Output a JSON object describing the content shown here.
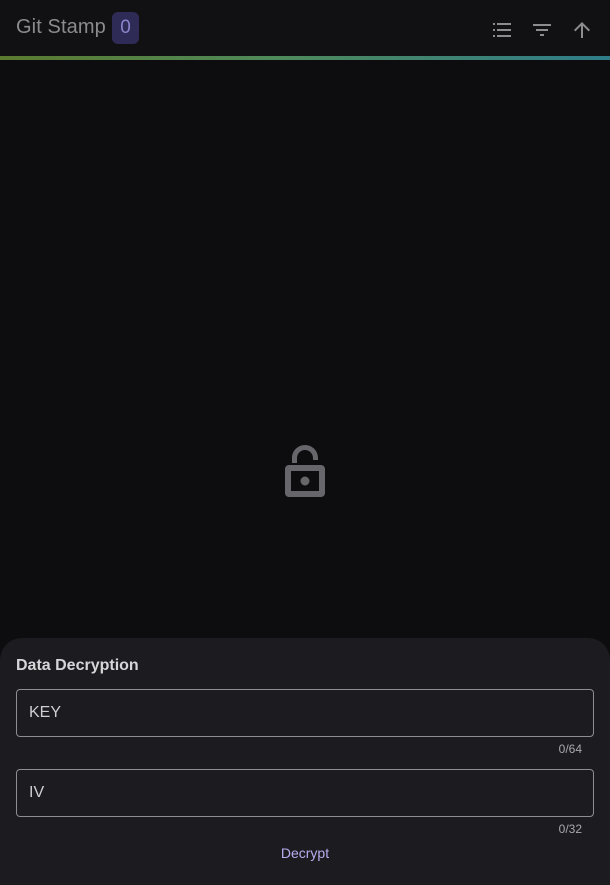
{
  "header": {
    "title": "Git Stamp",
    "count": "0",
    "icons": [
      "list-icon",
      "filter-icon",
      "arrow-up-icon"
    ]
  },
  "main": {
    "center_icon": "lock-open-icon"
  },
  "sheet": {
    "title": "Data Decryption",
    "key_field": {
      "placeholder": "KEY",
      "value": "",
      "counter": "0/64"
    },
    "iv_field": {
      "placeholder": "IV",
      "value": "",
      "counter": "0/32"
    },
    "decrypt_label": "Decrypt"
  },
  "colors": {
    "background": "#0d0d0f",
    "sheet": "#1c1b1f",
    "accent": "#b7aef0",
    "badge": "#2f2b57"
  }
}
